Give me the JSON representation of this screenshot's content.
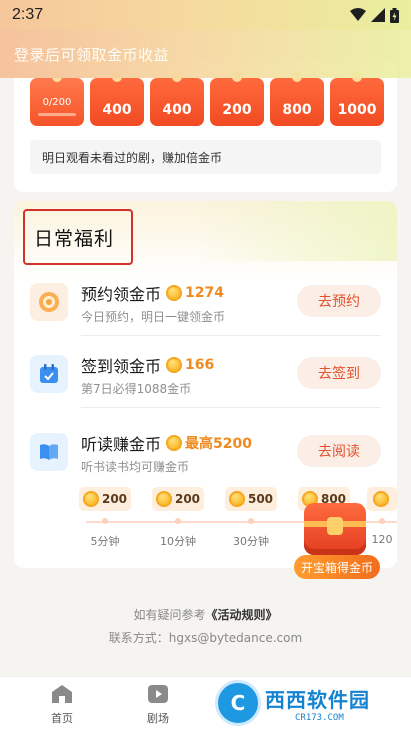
{
  "status_bar": {
    "time": "2:37"
  },
  "banner": {
    "text": "登录后可领取金币收益"
  },
  "coin_row": [
    "0/200",
    "400",
    "400",
    "200",
    "800",
    "1000"
  ],
  "tip": "明日观看未看过的剧，赚加倍金币",
  "daily": {
    "title": "日常福利",
    "tasks": [
      {
        "title": "预约领金币",
        "reward": "1274",
        "desc": "今日预约，明日一键领金币",
        "button": "去预约",
        "icon": "coin-badge-icon"
      },
      {
        "title": "签到领金币",
        "reward": "166",
        "desc": "第7日必得1088金币",
        "button": "去签到",
        "icon": "calendar-icon"
      },
      {
        "title": "听读赚金币",
        "reward": "最高5200",
        "desc": "听书读书均可赚金币",
        "button": "去阅读",
        "icon": "book-icon"
      }
    ],
    "milestones": [
      {
        "coins": "200",
        "label": "5分钟"
      },
      {
        "coins": "200",
        "label": "10分钟"
      },
      {
        "coins": "500",
        "label": "30分钟"
      },
      {
        "coins": "800",
        "label": ""
      },
      {
        "coins": "",
        "label": "120"
      }
    ],
    "chest_button": "开宝箱得金币"
  },
  "footer": {
    "note_prefix": "如有疑问参考",
    "rules_link": "《活动规则》",
    "contact": "联系方式：hgxs@bytedance.com"
  },
  "nav": [
    {
      "label": "首页",
      "icon": "home-icon"
    },
    {
      "label": "剧场",
      "icon": "play-icon"
    }
  ],
  "watermark": {
    "logo": "C",
    "main": "西西软件园",
    "sub": "CR173.COM"
  },
  "colors": {
    "accent": "#f14a22",
    "coin": "#f08a1e",
    "highlight_border": "#d3312a"
  }
}
